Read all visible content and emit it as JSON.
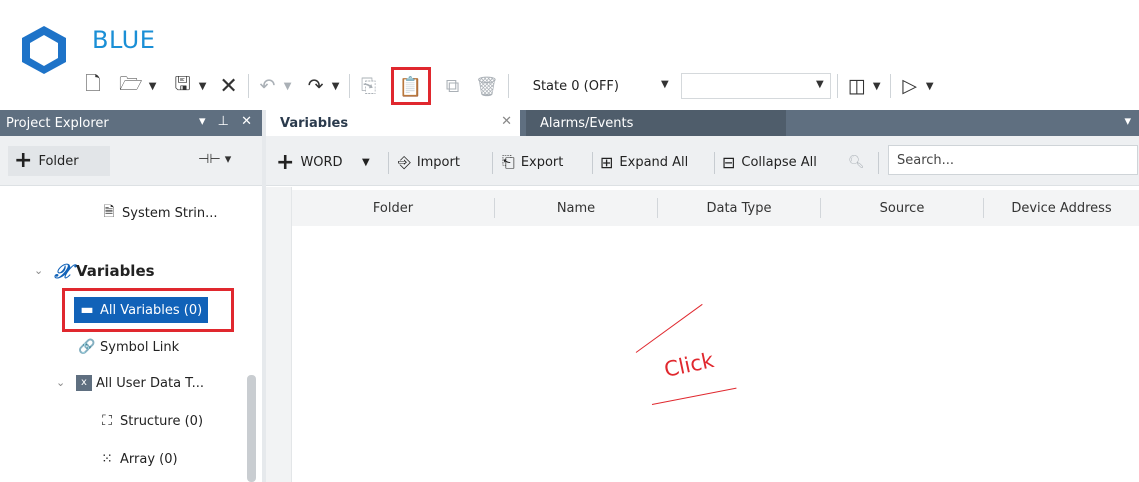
{
  "app": {
    "title": "BLUE"
  },
  "toolbar": {
    "state": {
      "value": "State 0 (OFF)"
    },
    "icons": [
      "new-file-icon",
      "open-folder-icon",
      "save-icon",
      "delete-icon",
      "undo-icon",
      "redo-icon",
      "copy-icon",
      "paste-icon",
      "duplicate-icon",
      "trash-icon",
      "layout-icon",
      "play-icon"
    ],
    "highlight_color": "#e0282e"
  },
  "project_explorer": {
    "title": "Project Explorer",
    "folder_button": "Folder",
    "tree": {
      "system_strings": "System Strin...",
      "variables": "Variables",
      "all_variables": "All Variables (0)",
      "symbol_link": "Symbol Link",
      "all_user_data_types": "All User Data T...",
      "structure": "Structure (0)",
      "array": "Array (0)"
    }
  },
  "tabs": [
    {
      "label": "Variables",
      "active": true
    },
    {
      "label": "Alarms/Events",
      "active": false
    }
  ],
  "doc_toolbar": {
    "add_label": "WORD",
    "import_label": "Import",
    "export_label": "Export",
    "expand_all_label": "Expand All",
    "collapse_all_label": "Collapse All",
    "search_placeholder": "Search..."
  },
  "grid": {
    "columns": [
      "Folder",
      "Name",
      "Data Type",
      "Source",
      "Device Address"
    ]
  },
  "annotation": {
    "click_text": "Click"
  },
  "colors": {
    "brand": "#1a8fd6",
    "header": "#5f6f80",
    "selection": "#1162b8",
    "annotation": "#e0282e"
  }
}
